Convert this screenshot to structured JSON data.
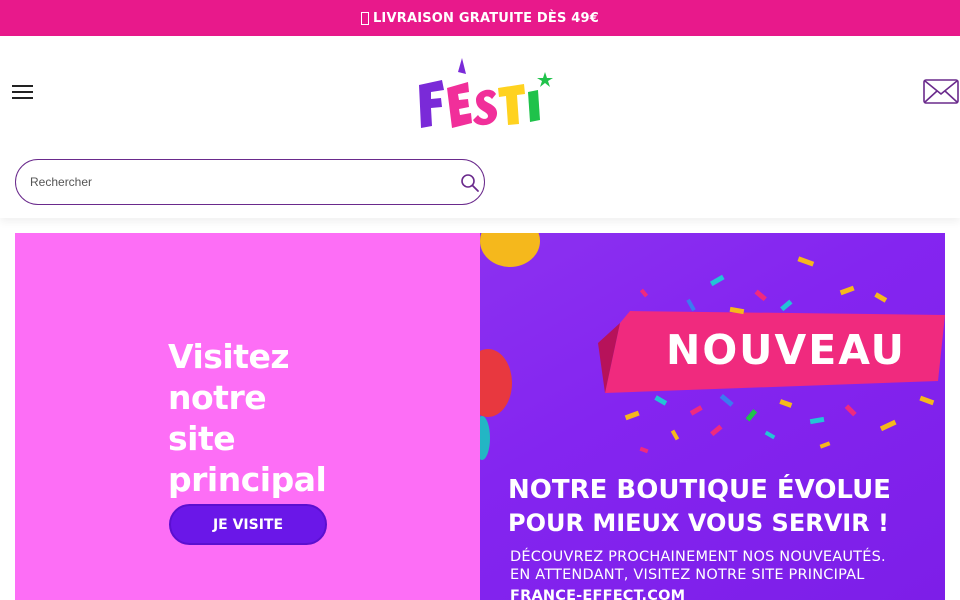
{
  "promo_bar": {
    "text": "LIVRAISON GRATUITE DÈS 49€",
    "icon": "truck-icon",
    "color": "#e8198b"
  },
  "header": {
    "menu_icon": "hamburger-icon",
    "logo_text": "FESTI",
    "mail_icon": "envelope-icon"
  },
  "search": {
    "placeholder": "Rechercher",
    "value": "",
    "icon": "search-icon",
    "border_color": "#6a2a8c"
  },
  "banner": {
    "left": {
      "bg_color": "#fd6ef6",
      "headline_lines": [
        "Visitez",
        "notre",
        "site",
        "principal"
      ],
      "button_label": "JE VISITE",
      "button_color": "#6a17e8"
    },
    "right": {
      "bg_color": "#8425f0",
      "ribbon_text": "NOUVEAU",
      "ribbon_color": "#f02a7e",
      "headline_1": "NOTRE BOUTIQUE ÉVOLUE",
      "headline_2": "POUR MIEUX VOUS SERVIR !",
      "line_1": "DÉCOUVREZ PROCHAINEMENT NOS NOUVEAUTÉS.",
      "line_2": "EN ATTENDANT, VISITEZ NOTRE SITE PRINCIPAL",
      "line_3": "FRANCE-EFFECT.COM"
    }
  }
}
